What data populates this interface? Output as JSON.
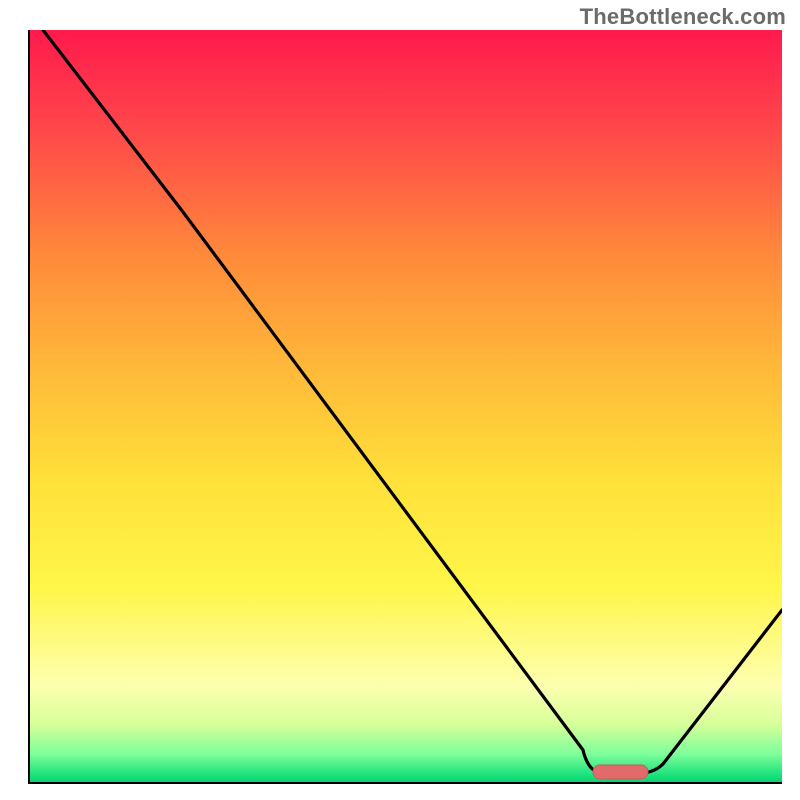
{
  "watermark": "TheBottleneck.com",
  "colors": {
    "gradient_top": "#ff1a4d",
    "gradient_mid": "#ffe13a",
    "gradient_bottom": "#0cc86f",
    "curve": "#000000",
    "marker": "#e16a6a"
  },
  "chart_data": {
    "type": "line",
    "title": "",
    "xlabel": "",
    "ylabel": "",
    "xlim": [
      0,
      100
    ],
    "ylim": [
      0,
      100
    ],
    "legend": null,
    "grid": false,
    "series": [
      {
        "name": "bottleneck-curve",
        "x": [
          2,
          20,
          73,
          76,
          79,
          83,
          100
        ],
        "values": [
          100,
          76,
          5,
          1,
          1,
          3,
          23
        ]
      }
    ],
    "annotations": [
      {
        "name": "optimal-marker",
        "shape": "pill",
        "x_range": [
          75,
          82
        ],
        "y": 2,
        "color": "#e16a6a"
      }
    ]
  }
}
